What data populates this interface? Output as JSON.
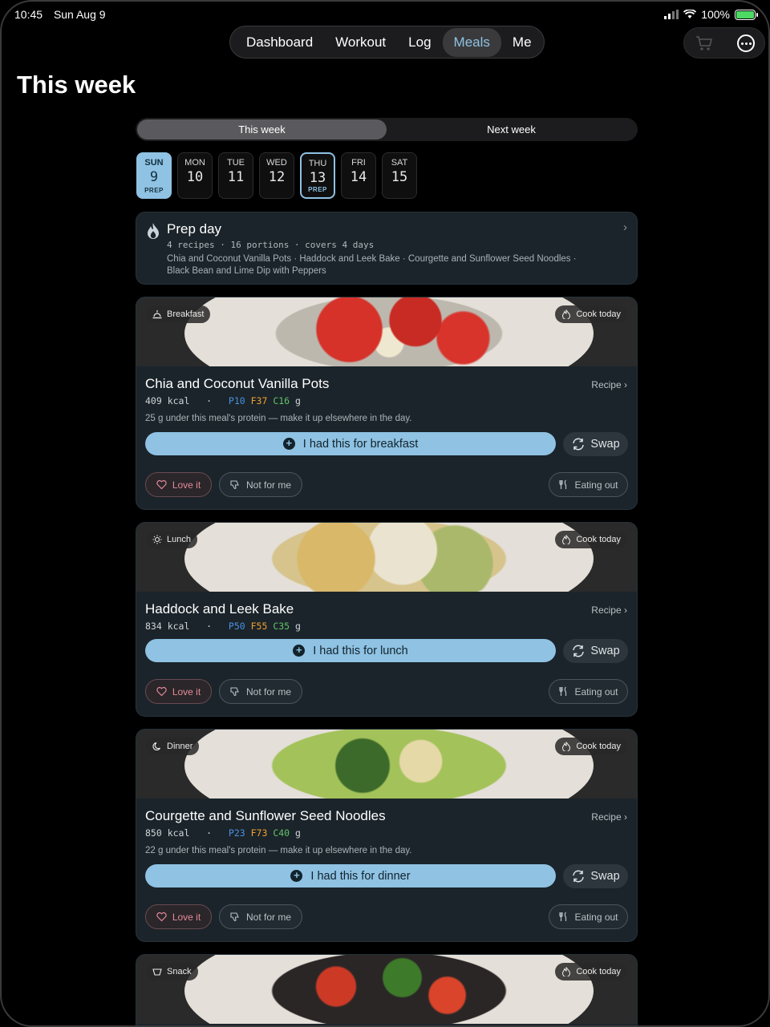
{
  "status": {
    "time": "10:45",
    "date": "Sun Aug 9",
    "battery": "100%"
  },
  "nav": {
    "tabs": [
      "Dashboard",
      "Workout",
      "Log",
      "Meals",
      "Me"
    ],
    "active": "Meals"
  },
  "page_title": "This week",
  "week_toggle": {
    "this_week": "This week",
    "next_week": "Next week"
  },
  "days": [
    {
      "name": "SUN",
      "num": "9",
      "tag": "PREP"
    },
    {
      "name": "MON",
      "num": "10",
      "tag": ""
    },
    {
      "name": "TUE",
      "num": "11",
      "tag": ""
    },
    {
      "name": "WED",
      "num": "12",
      "tag": ""
    },
    {
      "name": "THU",
      "num": "13",
      "tag": "PREP"
    },
    {
      "name": "FRI",
      "num": "14",
      "tag": ""
    },
    {
      "name": "SAT",
      "num": "15",
      "tag": ""
    }
  ],
  "prep": {
    "title": "Prep day",
    "meta": "4 recipes · 16 portions · covers 4 days",
    "recipes": "Chia and Coconut Vanilla Pots · Haddock and Leek Bake · Courgette and Sunflower Seed Noodles · Black Bean and Lime Dip with Peppers"
  },
  "common": {
    "cook_today": "Cook today",
    "recipe": "Recipe",
    "swap": "Swap",
    "love": "Love it",
    "not_for_me": "Not for me",
    "eating_out": "Eating out"
  },
  "meals": [
    {
      "type": "Breakfast",
      "title": "Chia and Coconut Vanilla Pots",
      "kcal": "409 kcal",
      "sep": "·",
      "p": "P10",
      "f": "F37",
      "c": "C16",
      "unit": "g",
      "note": "25 g under this meal's protein — make it up elsewhere in the day.",
      "had": "I had this for breakfast"
    },
    {
      "type": "Lunch",
      "title": "Haddock and Leek Bake",
      "kcal": "834 kcal",
      "sep": "·",
      "p": "P50",
      "f": "F55",
      "c": "C35",
      "unit": "g",
      "note": "",
      "had": "I had this for lunch"
    },
    {
      "type": "Dinner",
      "title": "Courgette and Sunflower Seed Noodles",
      "kcal": "850 kcal",
      "sep": "·",
      "p": "P23",
      "f": "F73",
      "c": "C40",
      "unit": "g",
      "note": "22 g under this meal's protein — make it up elsewhere in the day.",
      "had": "I had this for dinner"
    },
    {
      "type": "Snack"
    }
  ]
}
